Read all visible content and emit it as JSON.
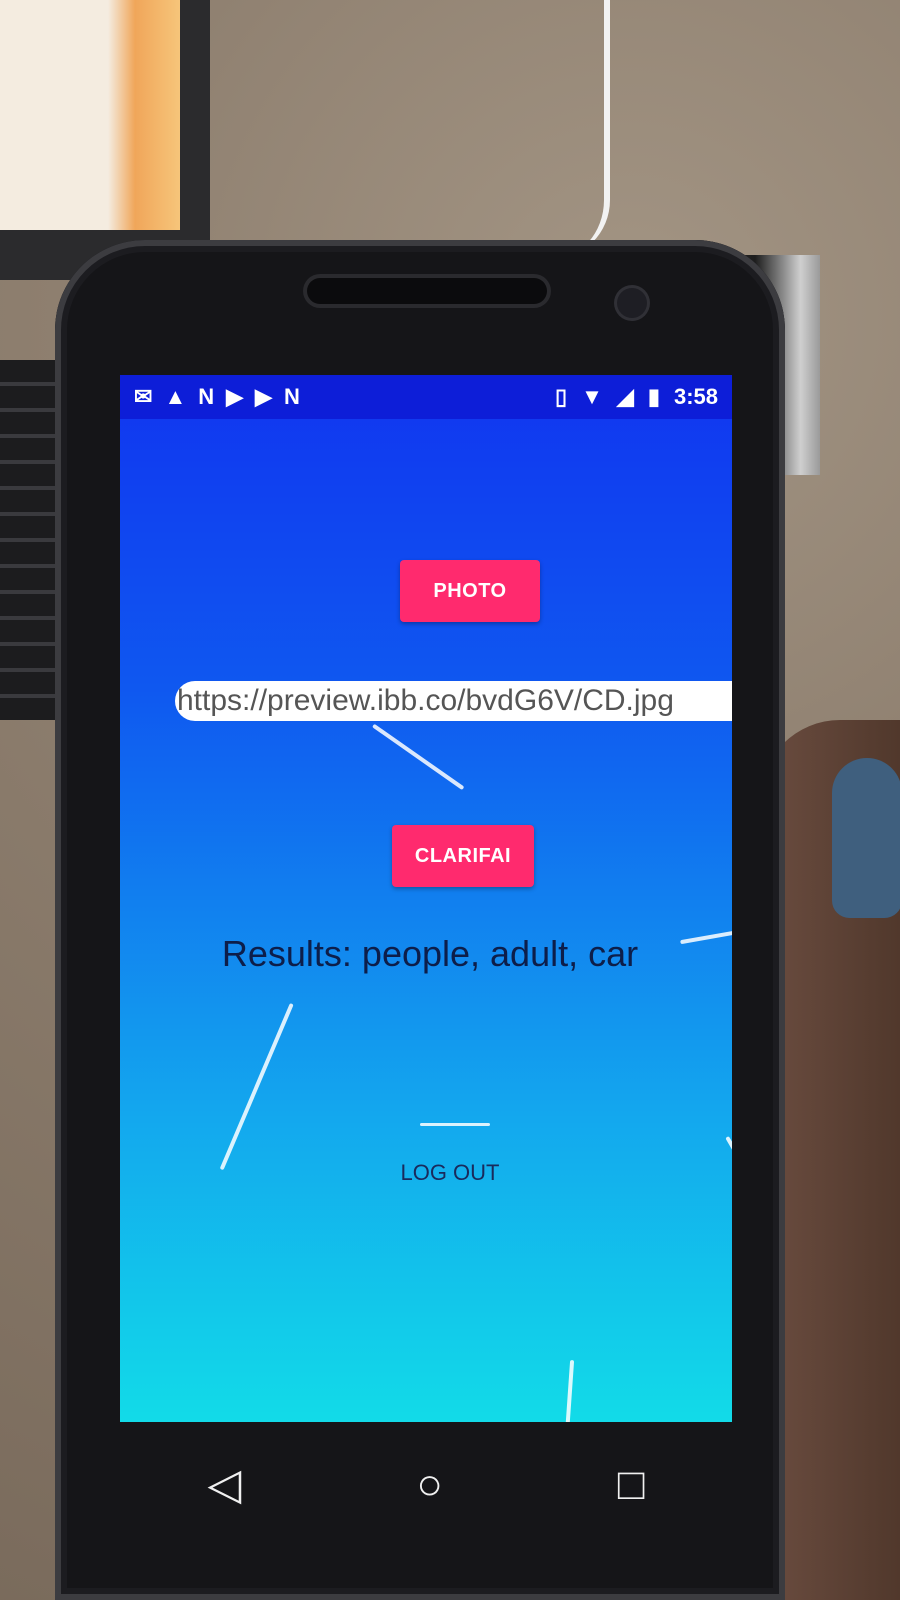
{
  "statusbar": {
    "left_icons": [
      "notification-mail-icon",
      "notification-alert-icon",
      "notification-n-icon",
      "notification-play-icon",
      "notification-play-icon",
      "notification-n-icon"
    ],
    "right_icons": [
      "vibrate-icon",
      "wifi-icon",
      "no-signal-icon",
      "battery-icon"
    ],
    "time": "3:58"
  },
  "main": {
    "photo_button_label": "PHOTO",
    "url_value": "https://preview.ibb.co/bvdG6V/CD.jpg",
    "clarifai_button_label": "CLARIFAI",
    "results_text": "Results: people, adult, car",
    "logout_label": "LOG OUT"
  },
  "navbar": {
    "back": "◁",
    "home": "○",
    "recents": "□"
  },
  "colors": {
    "accent": "#ff2a6e",
    "statusbar": "#0d1ed8",
    "background_top": "#1135f0",
    "background_bottom": "#12dbe8"
  }
}
